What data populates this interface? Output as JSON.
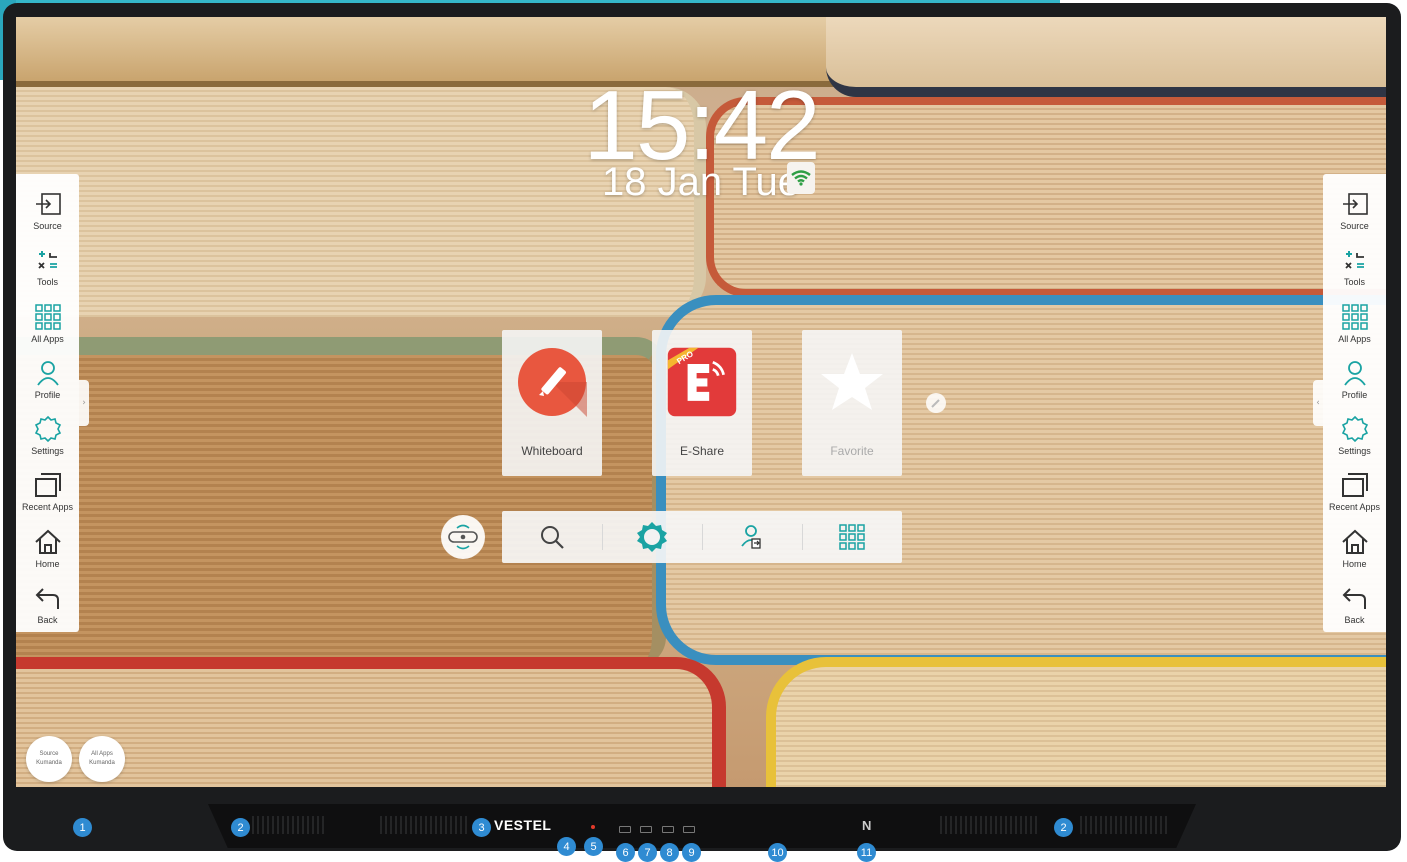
{
  "clock": {
    "time": "15:42",
    "date": "18 Jan Tue"
  },
  "sidebar": {
    "items": [
      {
        "label": "Source",
        "icon": "source-icon"
      },
      {
        "label": "Tools",
        "icon": "tools-icon"
      },
      {
        "label": "All Apps",
        "icon": "grid-icon"
      },
      {
        "label": "Profile",
        "icon": "profile-icon"
      },
      {
        "label": "Settings",
        "icon": "settings-icon"
      },
      {
        "label": "Recent Apps",
        "icon": "recent-apps-icon"
      },
      {
        "label": "Home",
        "icon": "home-icon"
      },
      {
        "label": "Back",
        "icon": "back-icon"
      }
    ],
    "handle_left": "›",
    "handle_right": "‹"
  },
  "tiles": [
    {
      "label": "Whiteboard",
      "icon": "whiteboard-icon",
      "color": "#e8573f"
    },
    {
      "label": "E-Share",
      "icon": "eshare-icon",
      "color": "#e23a3a",
      "badge": "PRO"
    },
    {
      "label": "Favorite",
      "icon": "star-icon"
    }
  ],
  "bottom_bar": {
    "buttons": [
      {
        "name": "search",
        "icon": "search-icon"
      },
      {
        "name": "settings",
        "icon": "settings-gear-icon"
      },
      {
        "name": "user-switch",
        "icon": "user-switch-icon"
      },
      {
        "name": "apps",
        "icon": "grid-icon"
      }
    ],
    "accent": "#1aa3a3"
  },
  "quick": [
    {
      "line1": "Source",
      "line2": "Kumanda"
    },
    {
      "line1": "All Apps",
      "line2": "Kumanda"
    }
  ],
  "hardware": {
    "brand": "VESTEL",
    "nfc": "N",
    "callouts": [
      "1",
      "2",
      "3",
      "4",
      "5",
      "6",
      "7",
      "8",
      "9",
      "10",
      "11",
      "2"
    ]
  },
  "colors": {
    "accent": "#1aa3a3",
    "callout": "#2f8bd2",
    "wifi": "#2e9e45"
  }
}
